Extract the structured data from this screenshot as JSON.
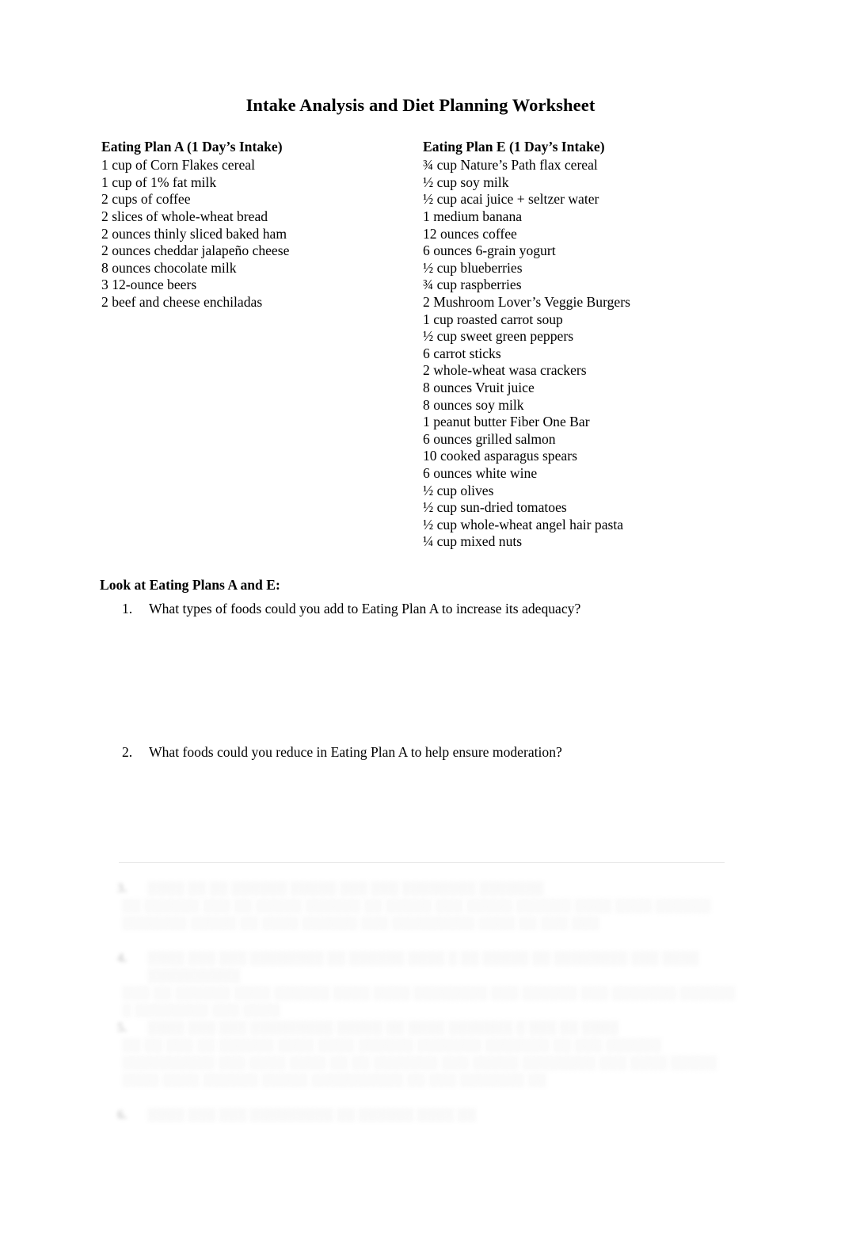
{
  "document": {
    "title": "Intake Analysis and Diet Planning Worksheet"
  },
  "plan_a": {
    "heading": "Eating Plan A (1 Day’s Intake)",
    "items": [
      "1 cup of Corn Flakes cereal",
      "1 cup of 1% fat milk",
      "2 cups of coffee",
      "2 slices of whole-wheat bread",
      "2 ounces thinly sliced baked ham",
      "2 ounces cheddar jalapeño cheese",
      "8 ounces chocolate milk",
      "3 12-ounce beers",
      "2 beef and cheese enchiladas"
    ]
  },
  "plan_e": {
    "heading": "Eating Plan E (1 Day’s Intake)",
    "items": [
      "¾ cup Nature’s Path flax cereal",
      "½ cup soy milk",
      "½ cup acai juice + seltzer water",
      "1 medium banana",
      "12 ounces coffee",
      "6 ounces 6-grain yogurt",
      "½ cup blueberries",
      "¾ cup raspberries",
      "2 Mushroom Lover’s Veggie Burgers",
      "1 cup roasted carrot soup",
      "½ cup sweet green peppers",
      "6 carrot sticks",
      "2 whole-wheat wasa crackers",
      "8 ounces Vruit juice",
      "8 ounces soy milk",
      "1 peanut butter Fiber One Bar",
      "6 ounces grilled salmon",
      "10 cooked asparagus spears",
      "6 ounces white wine",
      "½ cup olives",
      "½ cup sun-dried tomatoes",
      "½ cup whole-wheat angel hair pasta",
      "¼ cup mixed nuts"
    ]
  },
  "questions": {
    "heading": "Look at Eating Plans A and E:",
    "items": [
      {
        "number": "1.",
        "text": "What types of foods could you add to Eating Plan A to increase its adequacy?"
      },
      {
        "number": "2.",
        "text": "What foods could you reduce in Eating Plan A to help ensure moderation?"
      }
    ]
  },
  "faded_section": {
    "note": "Lower portion of page is faded and blurred; text is not legible.",
    "blocks": [
      {
        "number": "3.",
        "question": "░░░░ ░░ ░░ ░░░░░░ ░░░░░ ░░░ ░░░ ░░░░░░░░ ░░░░░░░",
        "answer": "░░ ░░░░░░ ░░░ ░░ ░░░░░ ░░░░░░ ░░ ░░░░░ ░░░ ░░░░░ ░░░░░░ ░░░░ ░░░░ ░░░░░░ ░░░░░░░ ░░░░░ ░░ ░░░░ ░░░░░░ ░░░ ░░░░░░░░░ ░░░░ ░░ ░░░ ░░░"
      },
      {
        "number": "4.",
        "question": "░░░░ ░░░ ░░░ ░░░░░░░░ ░░ ░░░░░░ ░░░░ ░ ░░ ░░░░░ ░░ ░░░░░░░░ ░░░ ░░░░ ░░░░░░░░░░",
        "answer": "░░░ ░░ ░░░░░░ ░░░░ ░░░░░░ ░░░░ ░░░░ ░░░░░░░░ ░░░ ░░░░░░ ░░░ ░░░░░░░ ░░░░░░ ░ ░░░░░░░░ ░░░ ░░░░"
      },
      {
        "number": "5.",
        "question": "░░░░ ░░░ ░░░ ░░░░░░░░░ ░░░░░ ░░ ░░░░ ░░░░░░░ ░ ░░░ ░░ ░░░░",
        "answer": "░░ ░░ ░░░ ░░ ░░░░░░ ░░░░ ░░░░ ░░░░░░ ░░░░░░░ ░░░░░░░ ░░ ░░░ ░░░░░░ ░░░░░░░░░░ ░░░ ░░░░ ░░░░ ░░ ░░ ░░░░░░░ ░░░ ░░░░░ ░░░░░░░░ ░░░ ░░░░ ░░░░░ ░░░░ ░░░░ ░░░░░░ ░░░░░ ░░░░░░░░░░ ░░ ░░░ ░░░░░░░ ░░"
      },
      {
        "number": "6.",
        "question": "░░░░ ░░░ ░░░ ░░░░░░░░░ ░░ ░░░░░░ ░░░░ ░░",
        "answer": ""
      }
    ]
  }
}
